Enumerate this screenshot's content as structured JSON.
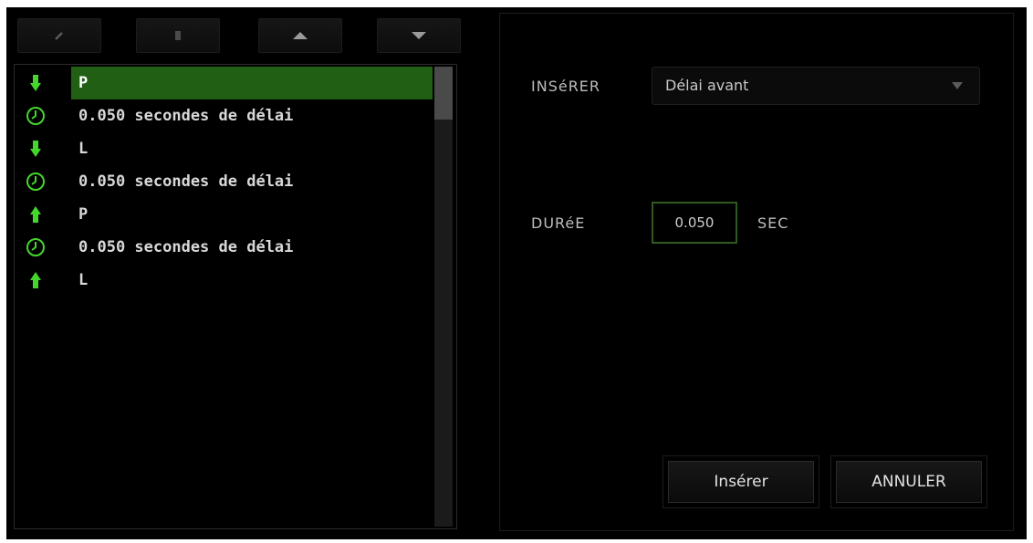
{
  "toolbar": {
    "buttons": [
      {
        "icon": "pencil-icon"
      },
      {
        "icon": "trash-icon"
      },
      {
        "icon": "arrow-up-icon"
      },
      {
        "icon": "arrow-down-icon"
      }
    ]
  },
  "macro_list": {
    "items": [
      {
        "icon": "key-down-arrow-icon",
        "label": "P",
        "selected": true
      },
      {
        "icon": "clock-icon",
        "label": "0.050 secondes de délai"
      },
      {
        "icon": "key-down-arrow-icon",
        "label": "L"
      },
      {
        "icon": "clock-icon",
        "label": "0.050 secondes de délai"
      },
      {
        "icon": "key-up-arrow-icon",
        "label": "P"
      },
      {
        "icon": "clock-icon",
        "label": "0.050 secondes de délai"
      },
      {
        "icon": "key-up-arrow-icon",
        "label": "L"
      }
    ]
  },
  "form": {
    "insert_label": "INSéRER",
    "insert_select_value": "Délai avant",
    "duration_label": "DURéE",
    "duration_value": "0.050",
    "duration_unit": "SEC",
    "insert_button": "Insérer",
    "cancel_button": "ANNULER"
  },
  "colors": {
    "accent_green": "#44d62c",
    "selected_row": "#205f14",
    "input_border": "#2f5a1f"
  }
}
